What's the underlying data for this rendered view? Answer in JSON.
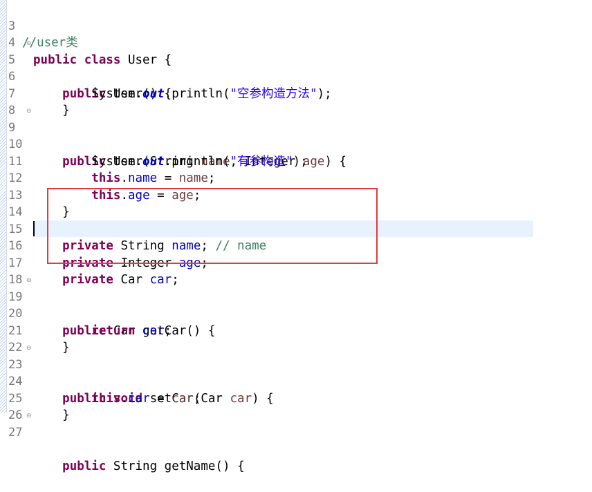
{
  "editor": {
    "colors": {
      "keyword": "#7f0055",
      "field": "#0000c0",
      "comment": "#3f7f5f",
      "string": "#2a00ff",
      "highlight_box": "#e03c3c",
      "current_line": "#e8f2fe"
    },
    "lines": [
      {
        "num": "3",
        "code": "//user类"
      },
      {
        "num": "4",
        "code": "public class User {"
      },
      {
        "num": "5",
        "code": "    public User() {"
      },
      {
        "num": "6",
        "code": "        System.out.println(\"空参构造方法\");"
      },
      {
        "num": "7",
        "code": "    }"
      },
      {
        "num": "8",
        "code": ""
      },
      {
        "num": "9",
        "code": "    public User(String name, Integer age) {"
      },
      {
        "num": "10",
        "code": "        System.out.println(\"有参构造\");"
      },
      {
        "num": "11",
        "code": "        this.name = name;"
      },
      {
        "num": "12",
        "code": "        this.age = age;"
      },
      {
        "num": "13",
        "code": "    }"
      },
      {
        "num": "14",
        "code": ""
      },
      {
        "num": "15",
        "code": "    private String name; // name"
      },
      {
        "num": "16",
        "code": "    private Integer age;"
      },
      {
        "num": "17",
        "code": "    private Car car;"
      },
      {
        "num": "18",
        "code": ""
      },
      {
        "num": "19",
        "code": "    public Car getCar() {"
      },
      {
        "num": "20",
        "code": "        return car;"
      },
      {
        "num": "21",
        "code": "    }"
      },
      {
        "num": "22",
        "code": ""
      },
      {
        "num": "23",
        "code": "    public void setCar(Car car) {"
      },
      {
        "num": "24",
        "code": "        this.car = car;"
      },
      {
        "num": "25",
        "code": "    }"
      },
      {
        "num": "26",
        "code": ""
      },
      {
        "num": "27",
        "code": "    public String getName() {"
      }
    ]
  }
}
